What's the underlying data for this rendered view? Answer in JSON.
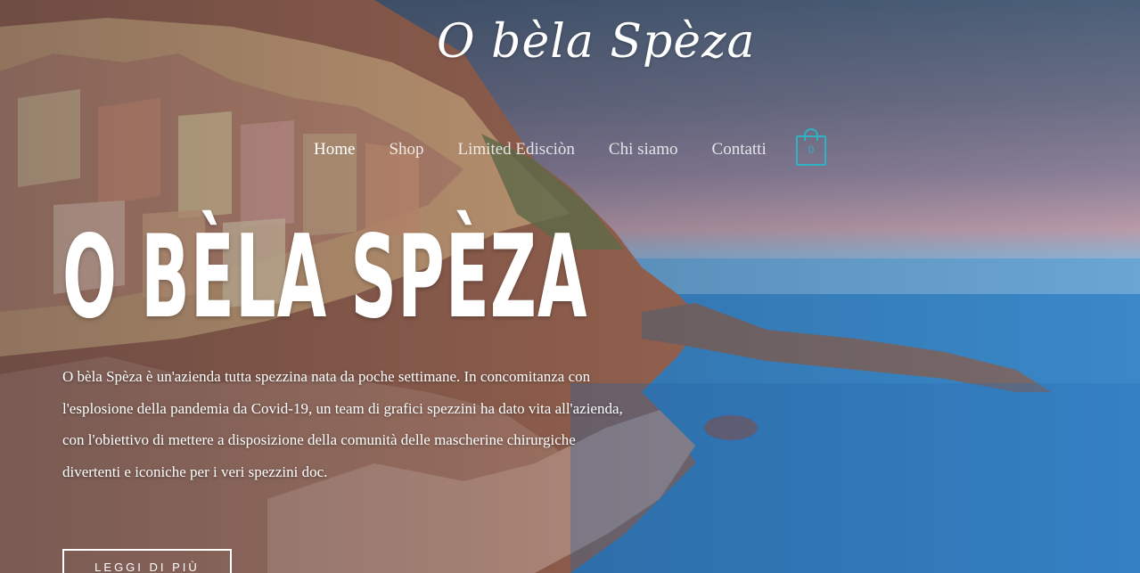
{
  "brand": {
    "logo_text": "O bèla Spèza"
  },
  "nav": {
    "items": [
      {
        "label": "Home",
        "active": true
      },
      {
        "label": "Shop",
        "active": false
      },
      {
        "label": "Limited Edisciòn",
        "active": false
      },
      {
        "label": "Chi siamo",
        "active": false
      },
      {
        "label": "Contatti",
        "active": false
      }
    ],
    "cart": {
      "icon": "shopping-bag-icon",
      "count": "0",
      "color": "#2fb3c4"
    }
  },
  "hero": {
    "headline": "O BÈLA SPÈZA",
    "intro": "O bèla Spèza è un'azienda tutta spezzina nata da poche settimane. In concomitanza con l'esplosione della pandemia da Covid-19, un team di grafici spezzini ha dato vita all'azienda, con l'obiettivo di mettere a disposizione della comunità delle mascherine chirurgiche divertenti e iconiche per i veri spezzini doc.",
    "cta_label": "LEGGI DI PIÙ"
  }
}
